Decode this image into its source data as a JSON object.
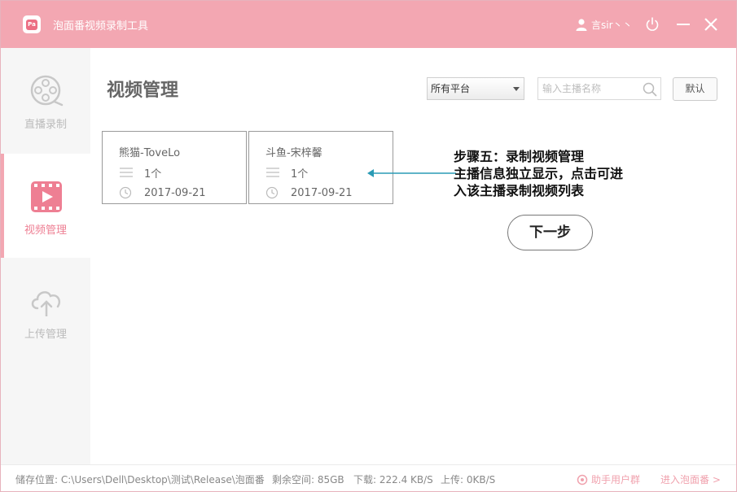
{
  "titlebar": {
    "app_title": "泡面番视频录制工具",
    "logo_text": "Pa",
    "user_name": "言sir丶丶"
  },
  "sidebar": {
    "items": [
      {
        "label": "直播录制",
        "icon": "film-reel-icon",
        "active": false
      },
      {
        "label": "视频管理",
        "icon": "video-play-icon",
        "active": true
      },
      {
        "label": "上传管理",
        "icon": "cloud-upload-icon",
        "active": false
      }
    ]
  },
  "main": {
    "page_title": "视频管理",
    "platform_select": {
      "value": "所有平台"
    },
    "search": {
      "placeholder": "输入主播名称"
    },
    "default_button": "默认",
    "cards": [
      {
        "name": "熊猫-ToveLo",
        "count": "1个",
        "date": "2017-09-21"
      },
      {
        "name": "斗鱼-宋梓馨",
        "count": "1个",
        "date": "2017-09-21"
      }
    ]
  },
  "annotation": {
    "line1": "步骤五：录制视频管理",
    "line2": "主播信息独立显示，点击可进",
    "line3": "入该主播录制视频列表",
    "next_button": "下一步"
  },
  "footer": {
    "path": "储存位置: C:\\Users\\Dell\\Desktop\\测试\\Release\\泡面番",
    "free_space": "剩余空间: 85GB",
    "download": "下载: 222.4 KB/S",
    "upload": "上传: 0KB/S",
    "help_group": "助手用户群",
    "enter_site": "进入泡面番 >"
  },
  "colors": {
    "accent": "#f3a7b2",
    "accent_dark": "#ee7f93",
    "annotation_arrow": "#2a9bb5"
  }
}
